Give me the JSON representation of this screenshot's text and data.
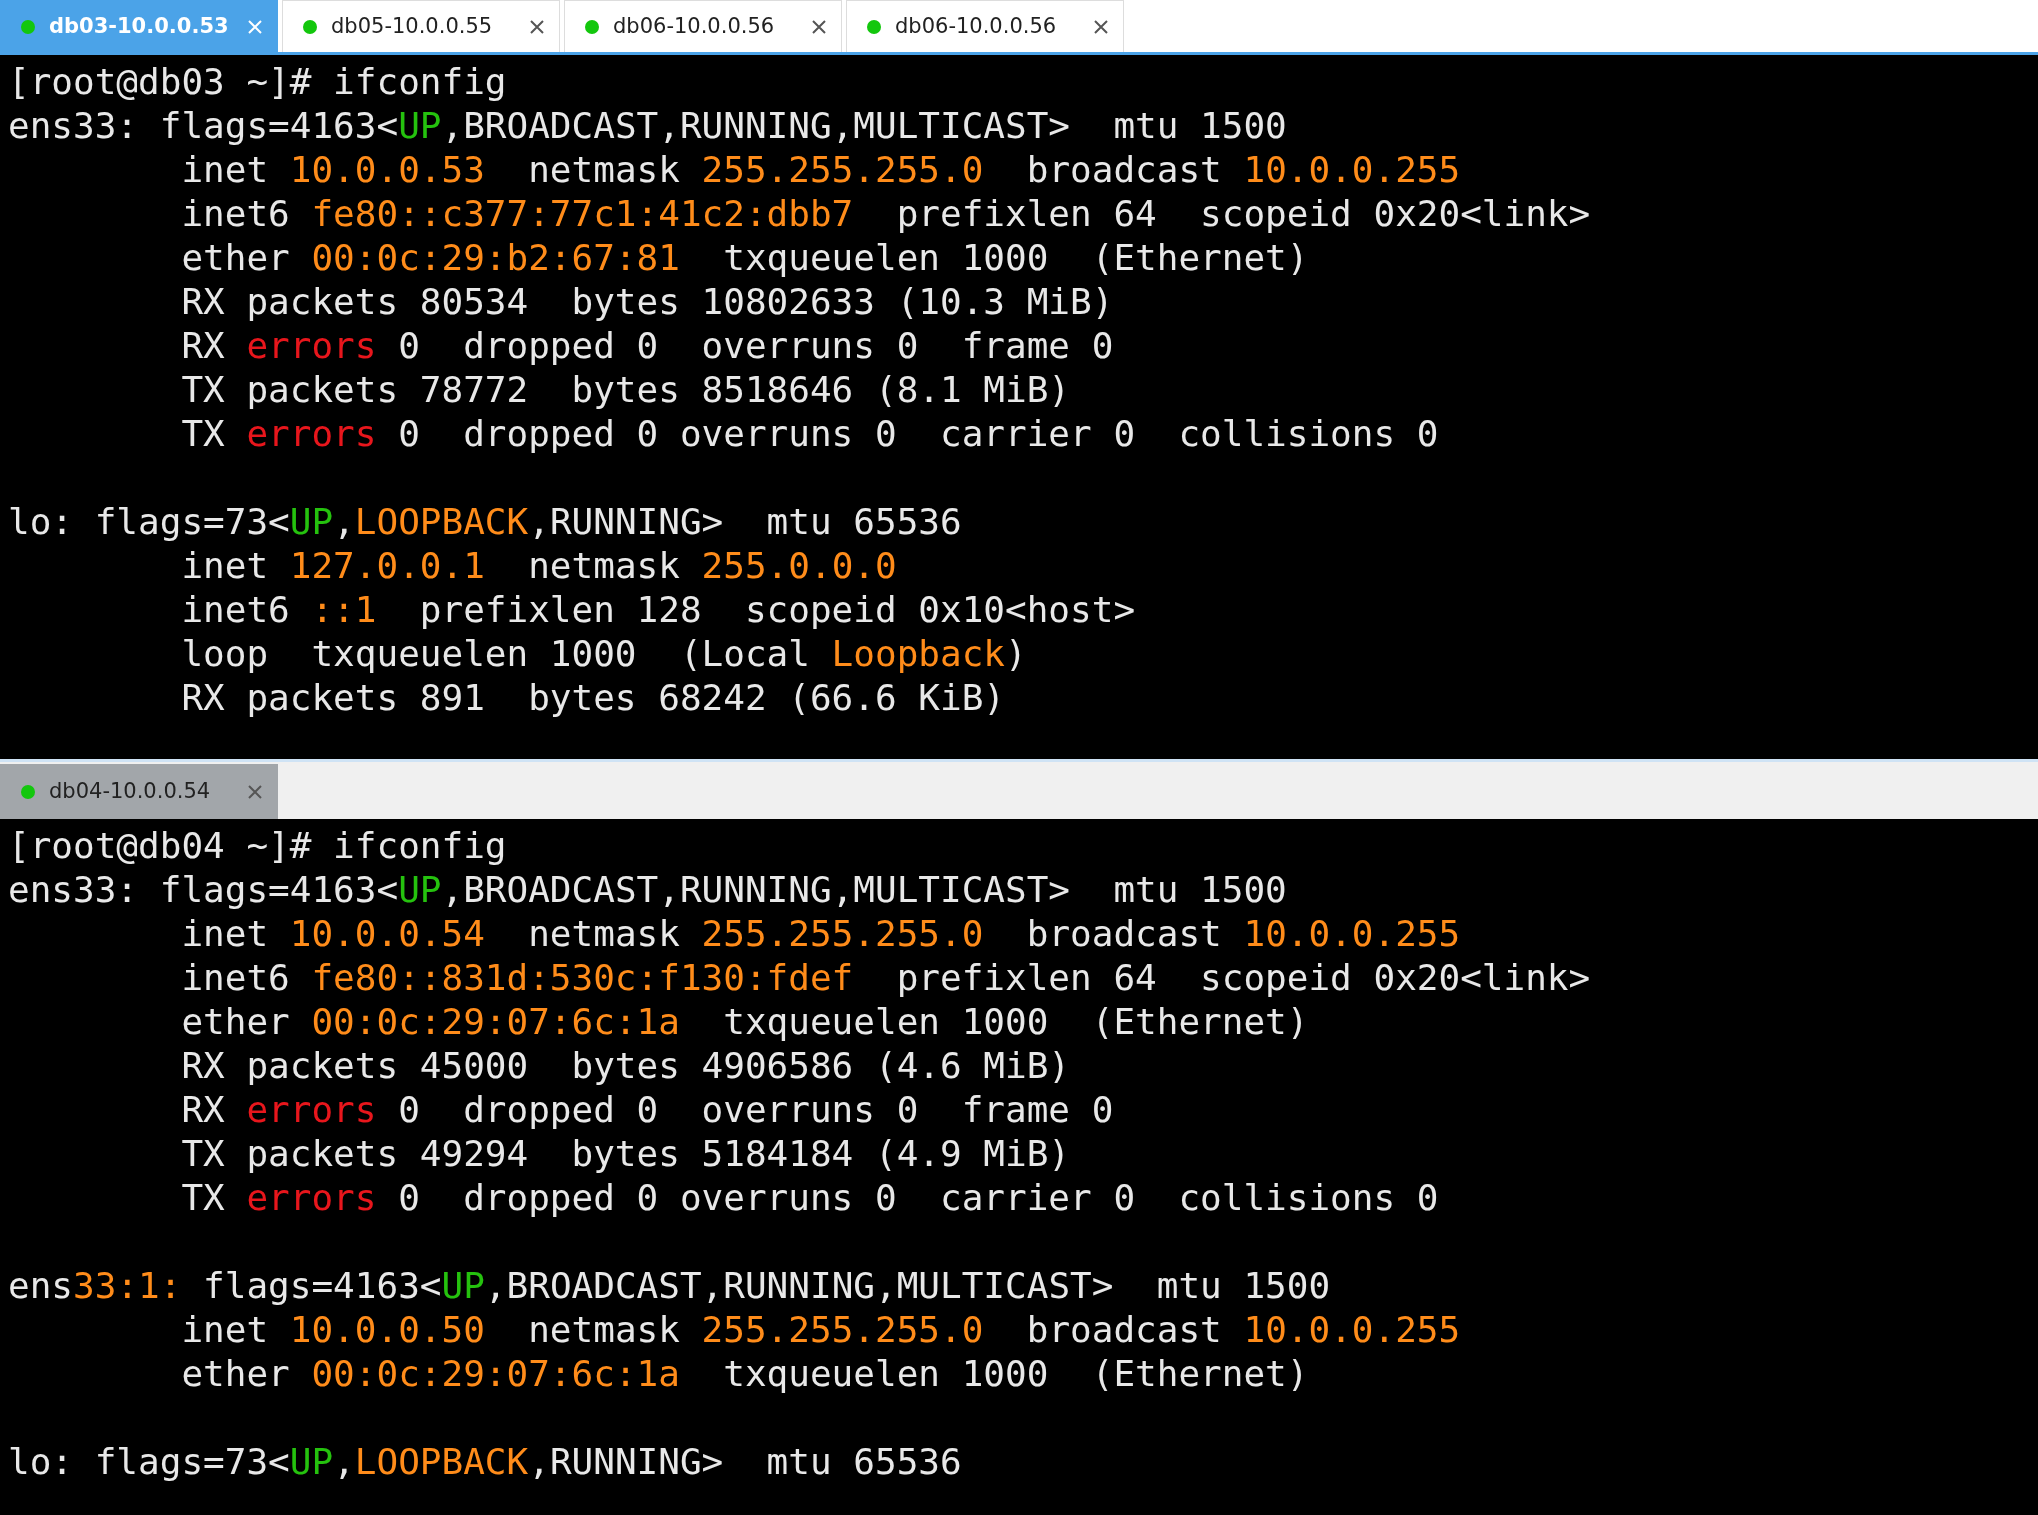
{
  "panes": [
    {
      "tabs": [
        {
          "label": "db03-10.0.0.53",
          "selected": true
        },
        {
          "label": "db05-10.0.0.55",
          "selected": false
        },
        {
          "label": "db06-10.0.0.56",
          "selected": false
        },
        {
          "label": "db06-10.0.0.56",
          "selected": false
        }
      ],
      "lines": [
        {
          "kind": "text",
          "segments": [
            {
              "kind": "plain",
              "text": "[root@db03 ~]# ifconfig"
            }
          ]
        },
        {
          "kind": "text",
          "segments": [
            {
              "kind": "plain",
              "text": "ens33: flags=4163<"
            },
            {
              "kind": "flag",
              "text": "UP"
            },
            {
              "kind": "plain",
              "text": ",BROADCAST,RUNNING,MULTICAST>  mtu 1500"
            }
          ]
        },
        {
          "kind": "text",
          "segments": [
            {
              "kind": "plain",
              "text": "        inet "
            },
            {
              "kind": "value",
              "text": "10.0.0.53"
            },
            {
              "kind": "plain",
              "text": "  netmask "
            },
            {
              "kind": "value",
              "text": "255.255.255.0"
            },
            {
              "kind": "plain",
              "text": "  broadcast "
            },
            {
              "kind": "value",
              "text": "10.0.0.255"
            }
          ]
        },
        {
          "kind": "text",
          "segments": [
            {
              "kind": "plain",
              "text": "        inet6 "
            },
            {
              "kind": "value",
              "text": "fe80::c377:77c1:41c2:dbb7"
            },
            {
              "kind": "plain",
              "text": "  prefixlen 64  scopeid 0x20<link>"
            }
          ]
        },
        {
          "kind": "text",
          "segments": [
            {
              "kind": "plain",
              "text": "        ether "
            },
            {
              "kind": "value",
              "text": "00:0c:29:b2:67:81"
            },
            {
              "kind": "plain",
              "text": "  txqueuelen 1000  (Ethernet)"
            }
          ]
        },
        {
          "kind": "text",
          "segments": [
            {
              "kind": "plain",
              "text": "        RX packets 80534  bytes 10802633 (10.3 MiB)"
            }
          ]
        },
        {
          "kind": "text",
          "segments": [
            {
              "kind": "plain",
              "text": "        RX "
            },
            {
              "kind": "error",
              "text": "errors"
            },
            {
              "kind": "plain",
              "text": " 0  dropped 0  overruns 0  frame 0"
            }
          ]
        },
        {
          "kind": "text",
          "segments": [
            {
              "kind": "plain",
              "text": "        TX packets 78772  bytes 8518646 (8.1 MiB)"
            }
          ]
        },
        {
          "kind": "text",
          "segments": [
            {
              "kind": "plain",
              "text": "        TX "
            },
            {
              "kind": "error",
              "text": "errors"
            },
            {
              "kind": "plain",
              "text": " 0  dropped 0 overruns 0  carrier 0  collisions 0"
            }
          ]
        },
        {
          "kind": "blank"
        },
        {
          "kind": "text",
          "segments": [
            {
              "kind": "plain",
              "text": "lo: flags=73<"
            },
            {
              "kind": "flag",
              "text": "UP"
            },
            {
              "kind": "plain",
              "text": ","
            },
            {
              "kind": "value",
              "text": "LOOPBACK"
            },
            {
              "kind": "plain",
              "text": ",RUNNING>  mtu 65536"
            }
          ]
        },
        {
          "kind": "text",
          "segments": [
            {
              "kind": "plain",
              "text": "        inet "
            },
            {
              "kind": "value",
              "text": "127.0.0.1"
            },
            {
              "kind": "plain",
              "text": "  netmask "
            },
            {
              "kind": "value",
              "text": "255.0.0.0"
            }
          ]
        },
        {
          "kind": "text",
          "segments": [
            {
              "kind": "plain",
              "text": "        inet6 "
            },
            {
              "kind": "value",
              "text": "::1"
            },
            {
              "kind": "plain",
              "text": "  prefixlen 128  scopeid 0x10<host>"
            }
          ]
        },
        {
          "kind": "text",
          "segments": [
            {
              "kind": "plain",
              "text": "        loop  txqueuelen 1000  (Local "
            },
            {
              "kind": "value",
              "text": "Loopback"
            },
            {
              "kind": "plain",
              "text": ")"
            }
          ]
        },
        {
          "kind": "text",
          "segments": [
            {
              "kind": "plain",
              "text": "        RX packets 891  bytes 68242 (66.6 KiB)"
            }
          ]
        }
      ]
    },
    {
      "tabs": [
        {
          "label": "db04-10.0.0.54",
          "selected": false
        }
      ],
      "lines": [
        {
          "kind": "text",
          "segments": [
            {
              "kind": "plain",
              "text": "[root@db04 ~]# ifconfig"
            }
          ]
        },
        {
          "kind": "text",
          "segments": [
            {
              "kind": "plain",
              "text": "ens33: flags=4163<"
            },
            {
              "kind": "flag",
              "text": "UP"
            },
            {
              "kind": "plain",
              "text": ",BROADCAST,RUNNING,MULTICAST>  mtu 1500"
            }
          ]
        },
        {
          "kind": "text",
          "segments": [
            {
              "kind": "plain",
              "text": "        inet "
            },
            {
              "kind": "value",
              "text": "10.0.0.54"
            },
            {
              "kind": "plain",
              "text": "  netmask "
            },
            {
              "kind": "value",
              "text": "255.255.255.0"
            },
            {
              "kind": "plain",
              "text": "  broadcast "
            },
            {
              "kind": "value",
              "text": "10.0.0.255"
            }
          ]
        },
        {
          "kind": "text",
          "segments": [
            {
              "kind": "plain",
              "text": "        inet6 "
            },
            {
              "kind": "value",
              "text": "fe80::831d:530c:f130:fdef"
            },
            {
              "kind": "plain",
              "text": "  prefixlen 64  scopeid 0x20<link>"
            }
          ]
        },
        {
          "kind": "text",
          "segments": [
            {
              "kind": "plain",
              "text": "        ether "
            },
            {
              "kind": "value",
              "text": "00:0c:29:07:6c:1a"
            },
            {
              "kind": "plain",
              "text": "  txqueuelen 1000  (Ethernet)"
            }
          ]
        },
        {
          "kind": "text",
          "segments": [
            {
              "kind": "plain",
              "text": "        RX packets 45000  bytes 4906586 (4.6 MiB)"
            }
          ]
        },
        {
          "kind": "text",
          "segments": [
            {
              "kind": "plain",
              "text": "        RX "
            },
            {
              "kind": "error",
              "text": "errors"
            },
            {
              "kind": "plain",
              "text": " 0  dropped 0  overruns 0  frame 0"
            }
          ]
        },
        {
          "kind": "text",
          "segments": [
            {
              "kind": "plain",
              "text": "        TX packets 49294  bytes 5184184 (4.9 MiB)"
            }
          ]
        },
        {
          "kind": "text",
          "segments": [
            {
              "kind": "plain",
              "text": "        TX "
            },
            {
              "kind": "error",
              "text": "errors"
            },
            {
              "kind": "plain",
              "text": " 0  dropped 0 overruns 0  carrier 0  collisions 0"
            }
          ]
        },
        {
          "kind": "blank"
        },
        {
          "kind": "text",
          "segments": [
            {
              "kind": "plain",
              "text": "ens"
            },
            {
              "kind": "value",
              "text": "33:1:"
            },
            {
              "kind": "plain",
              "text": " flags=4163<"
            },
            {
              "kind": "flag",
              "text": "UP"
            },
            {
              "kind": "plain",
              "text": ",BROADCAST,RUNNING,MULTICAST>  mtu 1500"
            }
          ]
        },
        {
          "kind": "text",
          "segments": [
            {
              "kind": "plain",
              "text": "        inet "
            },
            {
              "kind": "value",
              "text": "10.0.0.50"
            },
            {
              "kind": "plain",
              "text": "  netmask "
            },
            {
              "kind": "value",
              "text": "255.255.255.0"
            },
            {
              "kind": "plain",
              "text": "  broadcast "
            },
            {
              "kind": "value",
              "text": "10.0.0.255"
            }
          ]
        },
        {
          "kind": "text",
          "segments": [
            {
              "kind": "plain",
              "text": "        ether "
            },
            {
              "kind": "value",
              "text": "00:0c:29:07:6c:1a"
            },
            {
              "kind": "plain",
              "text": "  txqueuelen 1000  (Ethernet)"
            }
          ]
        },
        {
          "kind": "blank"
        },
        {
          "kind": "text",
          "segments": [
            {
              "kind": "plain",
              "text": "lo: flags=73<"
            },
            {
              "kind": "flag",
              "text": "UP"
            },
            {
              "kind": "plain",
              "text": ","
            },
            {
              "kind": "value",
              "text": "LOOPBACK"
            },
            {
              "kind": "plain",
              "text": ",RUNNING>  mtu 65536"
            }
          ]
        }
      ]
    }
  ]
}
